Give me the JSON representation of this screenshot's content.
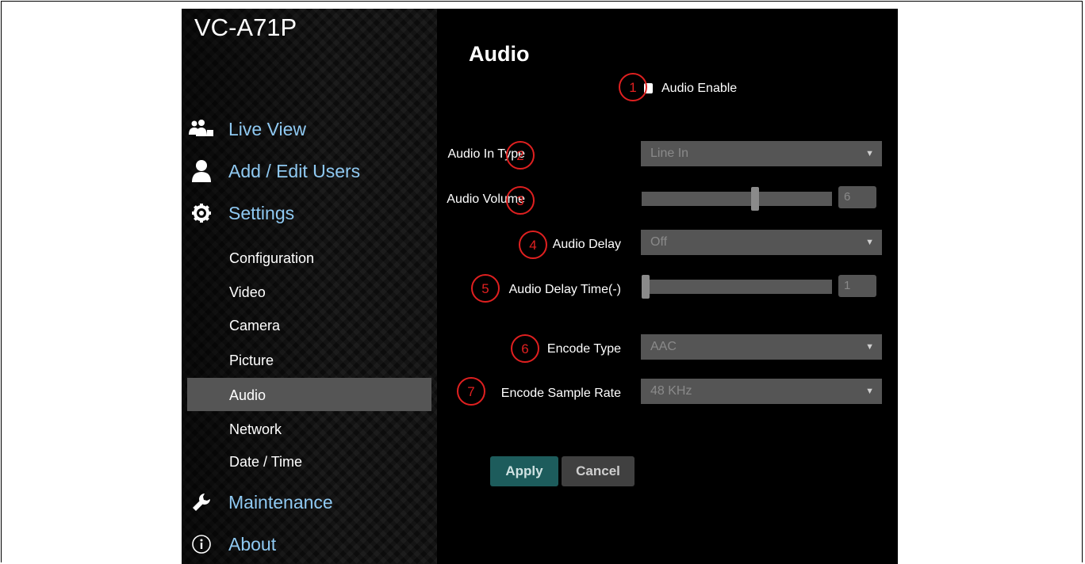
{
  "app": {
    "title": "VC-A71P"
  },
  "sidebar": {
    "main_items": [
      {
        "label": "Live View",
        "icon": "users-icon"
      },
      {
        "label": "Add / Edit Users",
        "icon": "user-icon"
      },
      {
        "label": "Settings",
        "icon": "gear-icon"
      },
      {
        "label": "Maintenance",
        "icon": "wrench-icon"
      },
      {
        "label": "About",
        "icon": "info-icon"
      }
    ],
    "sub_items": [
      {
        "label": "Configuration"
      },
      {
        "label": "Video"
      },
      {
        "label": "Camera"
      },
      {
        "label": "Picture"
      },
      {
        "label": "Audio",
        "active": true
      },
      {
        "label": "Network"
      },
      {
        "label": "Date / Time"
      }
    ]
  },
  "page": {
    "title": "Audio",
    "audio_enable": {
      "label": "Audio Enable",
      "checked": true,
      "marker": "1"
    },
    "audio_in_type": {
      "label": "Audio In Type",
      "value": "Line In",
      "marker": "2"
    },
    "audio_volume": {
      "label": "Audio Volume",
      "value": "6",
      "level": 0.6,
      "marker": "3"
    },
    "audio_delay": {
      "label": "Audio Delay",
      "value": "Off",
      "marker": "4"
    },
    "audio_delay_time": {
      "label": "Audio Delay Time(-)",
      "value": "1",
      "level": 0,
      "marker": "5"
    },
    "encode_type": {
      "label": "Encode Type",
      "value": "AAC",
      "marker": "6"
    },
    "encode_sample_rate": {
      "label": "Encode Sample Rate",
      "value": "48 KHz",
      "marker": "7"
    },
    "apply_label": "Apply",
    "cancel_label": "Cancel"
  },
  "colors": {
    "nav_link": "#8fc9f2",
    "apply_bg": "#1d5c5c",
    "cancel_bg": "#404040",
    "marker": "#e02020"
  }
}
